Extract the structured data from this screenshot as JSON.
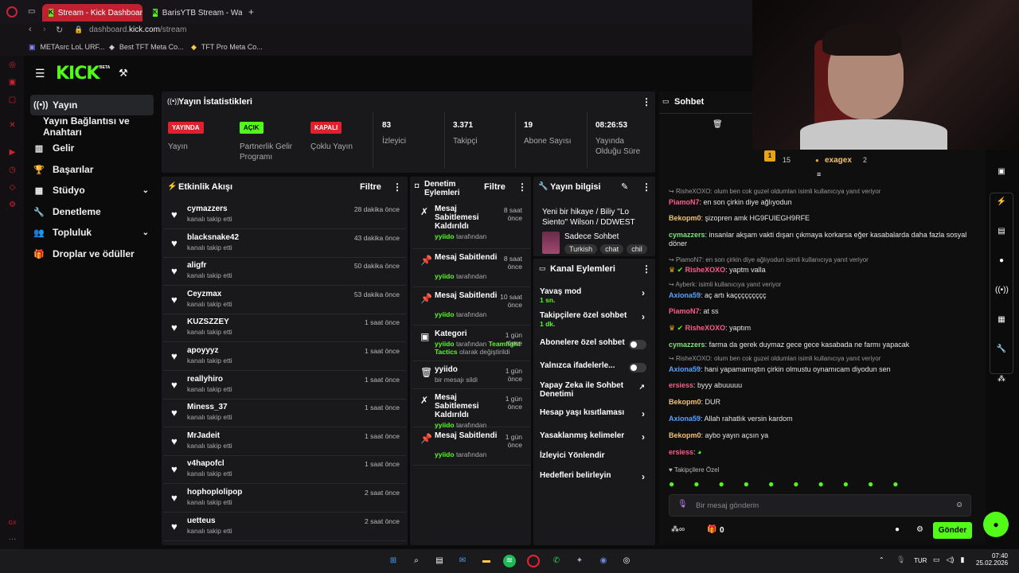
{
  "browser": {
    "tabs": [
      {
        "title": "Stream - Kick Dashboard"
      },
      {
        "title": "BarisYTB Stream - Watch"
      }
    ],
    "new_tab": "+",
    "url_prefix": "dashboard.",
    "url_domain": "kick.com",
    "url_path": "/stream",
    "bookmarks": [
      "METAsrc LoL URF...",
      "Best TFT Meta Co...",
      "TFT Pro Meta Co..."
    ]
  },
  "brand": {
    "logo": "KICK",
    "beta": "BETA"
  },
  "sidebar": {
    "items": [
      {
        "label": "Yayın",
        "icon": "broadcast-icon"
      },
      {
        "label": "Yayın Bağlantısı ve Anahtarı",
        "icon": "key-icon"
      },
      {
        "label": "Gelir",
        "icon": "chart-icon"
      },
      {
        "label": "Başarılar",
        "icon": "trophy-icon"
      },
      {
        "label": "Stüdyo",
        "icon": "studio-icon"
      },
      {
        "label": "Denetleme",
        "icon": "wrench-icon"
      },
      {
        "label": "Topluluk",
        "icon": "people-icon"
      },
      {
        "label": "Droplar ve ödüller",
        "icon": "gift-icon"
      }
    ]
  },
  "stats": {
    "title": "Yayın İstatistikleri",
    "items": [
      {
        "value": "YAYINDA",
        "label": "Yayın",
        "kind": "badge",
        "color": "#e0202e"
      },
      {
        "value": "AÇIK",
        "label": "Partnerlik Gelir Programı",
        "kind": "badge",
        "color": "#53fc18"
      },
      {
        "value": "KAPALI",
        "label": "Çoklu Yayın",
        "kind": "badge",
        "color": "#e0202e"
      },
      {
        "value": "83",
        "label": "İzleyici"
      },
      {
        "value": "3.371",
        "label": "Takipçi"
      },
      {
        "value": "19",
        "label": "Abone Sayısı"
      },
      {
        "value": "08:26:53",
        "label": "Yayında Olduğu Süre"
      }
    ]
  },
  "activity": {
    "title": "Etkinlik Akışı",
    "filter": "Filtre",
    "rows": [
      {
        "name": "cymazzers",
        "sub": "kanalı takip etti",
        "time": "28 dakika önce"
      },
      {
        "name": "blacksnake42",
        "sub": "kanalı takip etti",
        "time": "43 dakika önce"
      },
      {
        "name": "aligfr",
        "sub": "kanalı takip etti",
        "time": "50 dakika önce"
      },
      {
        "name": "Ceyzmax",
        "sub": "kanalı takip etti",
        "time": "53 dakika önce"
      },
      {
        "name": "KUZSZZEY",
        "sub": "kanalı takip etti",
        "time": "1 saat önce"
      },
      {
        "name": "apoyyyz",
        "sub": "kanalı takip etti",
        "time": "1 saat önce"
      },
      {
        "name": "reallyhiro",
        "sub": "kanalı takip etti",
        "time": "1 saat önce"
      },
      {
        "name": "Miness_37",
        "sub": "kanalı takip etti",
        "time": "1 saat önce"
      },
      {
        "name": "MrJadeit",
        "sub": "kanalı takip etti",
        "time": "1 saat önce"
      },
      {
        "name": "v4hapofcl",
        "sub": "kanalı takip etti",
        "time": "1 saat önce"
      },
      {
        "name": "hophoplolipop",
        "sub": "kanalı takip etti",
        "time": "2 saat önce"
      },
      {
        "name": "uetteus",
        "sub": "kanalı takip etti",
        "time": "2 saat önce"
      }
    ]
  },
  "moderation": {
    "title": "Denetim Eylemleri",
    "filter": "Filtre",
    "rows": [
      {
        "title": "Mesaj Sabitlemesi Kaldırıldı",
        "by_user": "yyiido",
        "by_text": "tarafından",
        "time": "8 saat önce",
        "icon": "unpin-icon"
      },
      {
        "title": "Mesaj Sabitlendi",
        "by_user": "yyiido",
        "by_text": "tarafından",
        "time": "8 saat önce",
        "icon": "pin-icon"
      },
      {
        "title": "Mesaj Sabitlendi",
        "by_user": "yyiido",
        "by_text": "tarafından",
        "time": "10 saat önce",
        "icon": "pin-icon"
      },
      {
        "title": "Kategori",
        "by_user": "yyiido",
        "by_text": "tarafından",
        "extra": "Teamfight Tactics",
        "extra_after": "olarak değiştirildi",
        "time": "1 gün önce",
        "icon": "category-icon"
      },
      {
        "title": "yyiido",
        "sub": "bir mesajı sildi",
        "time": "1 gün önce",
        "icon": "trash-icon"
      },
      {
        "title": "Mesaj Sabitlemesi Kaldırıldı",
        "by_user": "yyiido",
        "by_text": "tarafından",
        "time": "1 gün önce",
        "icon": "unpin-icon"
      },
      {
        "title": "Mesaj Sabitlendi",
        "by_user": "yyiido",
        "by_text": "tarafından",
        "time": "1 gün önce",
        "icon": "pin-icon"
      }
    ]
  },
  "stream_info": {
    "title": "Yayın bilgisi",
    "stream_title": "Yeni bir hikaye / Biliy ''Lo Siento'' Wilson / DDWEST",
    "category": "Sadece Sohbet",
    "tags": [
      "Turkish",
      "chat",
      "chil"
    ]
  },
  "channel_actions": {
    "title": "Kanal Eylemleri",
    "rows": [
      {
        "label": "Yavaş mod",
        "sub": "1 sn.",
        "control": "arrow"
      },
      {
        "label": "Takipçilere özel sohbet",
        "sub": "1 dk.",
        "control": "arrow"
      },
      {
        "label": "Abonelere özel sohbet",
        "control": "toggle"
      },
      {
        "label": "Yalnızca ifadelerle...",
        "control": "toggle"
      },
      {
        "label": "Yapay Zeka ile Sohbet Denetimi",
        "control": "external"
      },
      {
        "label": "Hesap yaşı kısıtlaması",
        "control": "arrow"
      },
      {
        "label": "Yasaklanmış kelimeler",
        "control": "arrow"
      },
      {
        "label": "İzleyici Yönlendir",
        "control": "none"
      },
      {
        "label": "Hedefleri belirleyin",
        "control": "arrow"
      }
    ]
  },
  "chat": {
    "title": "Sohbet",
    "leader_count_1": "15",
    "leader_name": "exagex",
    "leader_count_2": "2",
    "messages": [
      {
        "reply": "RisheXOXO: olum ben cok guzel oldumlan isimli kullanıcıya yanıt veriyor"
      },
      {
        "user": "PiamoN7",
        "color": "#ff5a8c",
        "text": "en son çirkin diye ağlıyodun"
      },
      {
        "user": "Bekopm0",
        "color": "#f5c26b",
        "text": "şizopren amk HG9FUIEGH9RFE"
      },
      {
        "user": "cymazzers",
        "color": "#7ee07e",
        "text": "insanlar akşam vakti dışarı çıkmaya korkarsa eğer kasabalarda daha fazla sosyal döner"
      },
      {
        "reply": "PiamoN7: en son çirkin diye ağlıyodun isimli kullanıcıya yanıt veriyor"
      },
      {
        "user": "RisheXOXO",
        "color": "#ff5a8c",
        "text": "yaptm valla",
        "badges": true
      },
      {
        "reply": "Ayberk: isimli kullanıcıya yanıt veriyor"
      },
      {
        "user": "Axiona59",
        "color": "#5aa0ff",
        "text": "aç artı kaççççççççç"
      },
      {
        "user": "PiamoN7",
        "color": "#ff5a8c",
        "text": "at ss"
      },
      {
        "user": "RisheXOXO",
        "color": "#ff5a8c",
        "text": "yaptım",
        "badges": true
      },
      {
        "user": "cymazzers",
        "color": "#7ee07e",
        "text": "farma da gerek duymaz gece gece kasabada ne farmı yapacak"
      },
      {
        "reply": "RisheXOXO: olum ben cok guzel oldumlan isimli kullanıcıya yanıt veriyor"
      },
      {
        "user": "Axiona59",
        "color": "#5aa0ff",
        "text": "hani yapamamıştın çirkin olmustu oynamıcam diyodun sen"
      },
      {
        "user": "ersiess",
        "color": "#ff5a8c",
        "text": "byyy abuuuuu"
      },
      {
        "user": "Bekopm0",
        "color": "#f5c26b",
        "text": "DUR"
      },
      {
        "user": "Axiona59",
        "color": "#5aa0ff",
        "text": "Allah rahatlık versin kardom"
      },
      {
        "user": "Bekopm0",
        "color": "#f5c26b",
        "text": "aybo yayın açsın ya"
      },
      {
        "user": "ersiess",
        "color": "#ff5a8c",
        "text": ""
      }
    ],
    "followers_only_label": "Takipçilere Özel",
    "input_placeholder": "Bir mesaj gönderin",
    "points": "0",
    "send_label": "Gönder"
  },
  "taskbar": {
    "lang": "TUR",
    "time": "07:40",
    "date": "25.02.2026"
  },
  "colors": {
    "kick_green": "#53fc18",
    "live_red": "#e0202e",
    "panel_bg": "#19191b"
  }
}
